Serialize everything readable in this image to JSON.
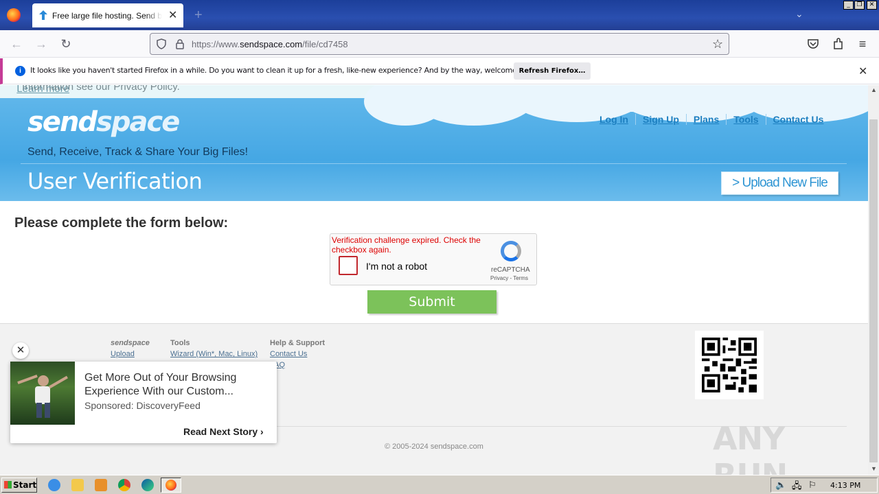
{
  "browser": {
    "tab_title": "Free large file hosting. Send big file",
    "url_prefix": "https://www.",
    "url_domain": "sendspace.com",
    "url_path": "/file/cd7458",
    "notification": "It looks like you haven't started Firefox in a while. Do you want to clean it up for a fresh, like-new experience? And by the way, welcome back!",
    "notification_button": "Refresh Firefox…"
  },
  "page": {
    "cookie_text": "Information see our Privacy Policy.",
    "cookie_link": "Learn more",
    "logo_a": "send",
    "logo_b": "space",
    "tagline": "Send, Receive, Track & Share Your Big Files!",
    "top_links": [
      "Log In",
      "Sign Up",
      "Plans",
      "Tools",
      "Contact Us"
    ],
    "title": "User Verification",
    "upload_button": "> Upload New File",
    "form_heading": "Please complete the form below:",
    "captcha": {
      "error": "Verification challenge expired. Check the checkbox again.",
      "label": "I'm not a robot",
      "brand": "reCAPTCHA",
      "links": "Privacy - Terms"
    },
    "submit": "Submit"
  },
  "footer": {
    "col1_heading": "sendspace",
    "col1_links": [
      "Upload"
    ],
    "col2_heading": "Tools",
    "col2_links": [
      "Wizard (Win*, Mac, Linux)"
    ],
    "col3_heading": "Help & Support",
    "col3_links": [
      "Contact Us",
      "FAQ"
    ],
    "copyright": "© 2005-2024 sendspace.com",
    "watermark": "ANY RUN"
  },
  "ad": {
    "title": "Get More Out of Your Browsing Experience With our Custom...",
    "sponsor": "Sponsored: DiscoveryFeed",
    "next": "Read Next Story"
  },
  "taskbar": {
    "start": "Start",
    "clock": "4:13 PM"
  }
}
